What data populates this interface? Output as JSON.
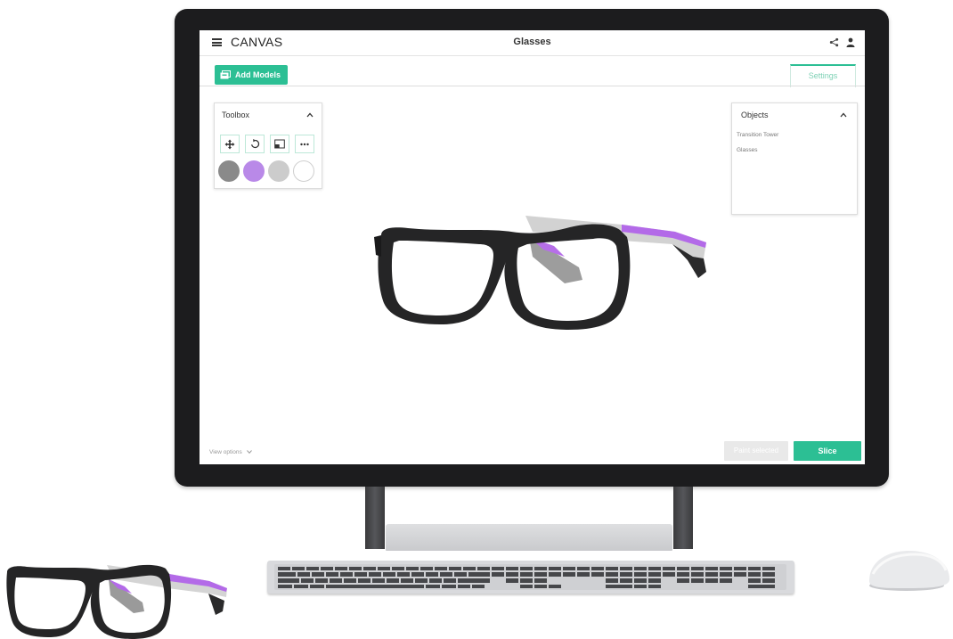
{
  "app": {
    "name": "CANVAS",
    "document_title": "Glasses"
  },
  "toolbar": {
    "add_models_label": "Add Models",
    "settings_tab_label": "Settings"
  },
  "toolbox": {
    "title": "Toolbox",
    "tools": [
      {
        "name": "move",
        "icon": "move-arrows-icon"
      },
      {
        "name": "rotate",
        "icon": "rotate-icon"
      },
      {
        "name": "scale",
        "icon": "scale-icon"
      },
      {
        "name": "more",
        "icon": "more-dots-icon"
      }
    ],
    "swatches": [
      {
        "color": "#8a8a8a"
      },
      {
        "color": "#b989e8"
      },
      {
        "color": "#cccccc"
      },
      {
        "color": "#ffffff"
      }
    ]
  },
  "objects": {
    "title": "Objects",
    "items": [
      "Transition Tower",
      "Glasses"
    ]
  },
  "footer": {
    "view_options_label": "View options",
    "paint_selected_label": "Paint selected",
    "slice_label": "Slice"
  },
  "colors": {
    "accent": "#2cbf94",
    "frame": "#252526",
    "purple": "#b36ae8",
    "monitor": "#1c1c1e"
  }
}
